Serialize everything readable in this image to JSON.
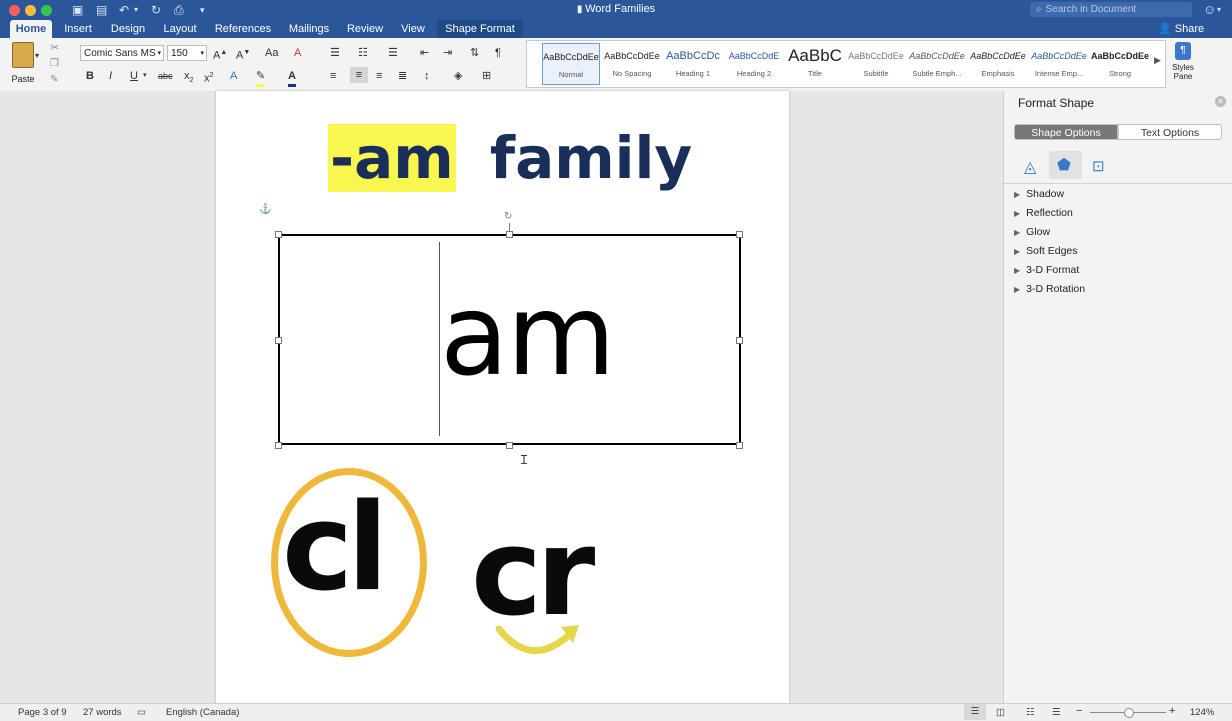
{
  "window": {
    "title": "Word Families"
  },
  "search": {
    "placeholder": "Search in Document"
  },
  "share_label": "Share",
  "tabs": [
    "Home",
    "Insert",
    "Design",
    "Layout",
    "References",
    "Mailings",
    "Review",
    "View",
    "Shape Format"
  ],
  "ribbon": {
    "paste_label": "Paste",
    "font_name": "Comic Sans MS",
    "font_size": "150",
    "styles_pane_label": "Styles Pane",
    "styles": [
      {
        "preview": "AaBbCcDdEe",
        "name": "Normal"
      },
      {
        "preview": "AaBbCcDdEe",
        "name": "No Spacing"
      },
      {
        "preview": "AaBbCcDc",
        "name": "Heading 1"
      },
      {
        "preview": "AaBbCcDdE",
        "name": "Heading 2"
      },
      {
        "preview": "AaBbC",
        "name": "Title"
      },
      {
        "preview": "AaBbCcDdEe",
        "name": "Subtitle"
      },
      {
        "preview": "AaBbCcDdEe",
        "name": "Subtle Emph..."
      },
      {
        "preview": "AaBbCcDdEe",
        "name": "Emphasis"
      },
      {
        "preview": "AaBbCcDdEe",
        "name": "Intense Emp..."
      },
      {
        "preview": "AaBbCcDdEe",
        "name": "Strong"
      }
    ]
  },
  "document": {
    "heading_highlight": "-am",
    "heading_rest": "family",
    "textbox_text": "am",
    "blend_1": "cl",
    "blend_2": "cr"
  },
  "format_pane": {
    "title": "Format Shape",
    "shape_options": "Shape Options",
    "text_options": "Text Options",
    "sections": [
      "Shadow",
      "Reflection",
      "Glow",
      "Soft Edges",
      "3-D Format",
      "3-D Rotation"
    ]
  },
  "status": {
    "page": "Page 3 of 9",
    "words": "27 words",
    "language": "English (Canada)",
    "zoom": "124%"
  },
  "colors": {
    "accent": "#2b579a",
    "highlight": "#f9f64f",
    "heading_text": "#1a2e5a",
    "circle": "#f0b83a"
  }
}
